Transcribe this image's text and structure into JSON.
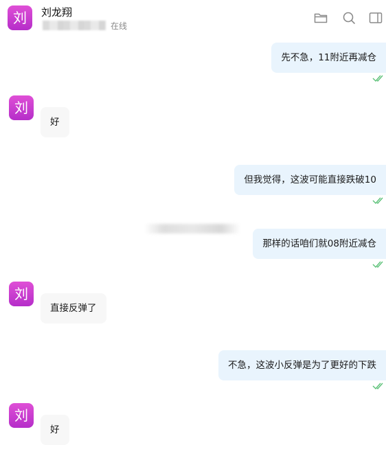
{
  "header": {
    "avatar_char": "刘",
    "contact_name": "刘龙翔",
    "presence": "在线",
    "icons": [
      "folder-icon",
      "search-icon",
      "sidebar-toggle-icon"
    ]
  },
  "colors": {
    "avatar_gradient_top": "#df4fd6",
    "avatar_gradient_bottom": "#b52ec9",
    "outgoing_bubble": "#e9f4fd",
    "incoming_bubble": "#f7f7f7",
    "read_check": "#5cc178"
  },
  "messages": [
    {
      "direction": "out",
      "text": "先不急，11附近再减仓",
      "status": "read"
    },
    {
      "direction": "in",
      "avatar_char": "刘",
      "text": "好"
    },
    {
      "direction": "out",
      "text": "但我觉得，这波可能直接跌破10",
      "status": "read"
    },
    {
      "direction": "out",
      "text": "那样的话咱们就08附近减仓",
      "status": "read"
    },
    {
      "direction": "in",
      "avatar_char": "刘",
      "text": "直接反弹了"
    },
    {
      "direction": "out",
      "text": "不急，这波小反弹是为了更好的下跌",
      "status": "read"
    },
    {
      "direction": "in",
      "avatar_char": "刘",
      "text": "好"
    }
  ]
}
